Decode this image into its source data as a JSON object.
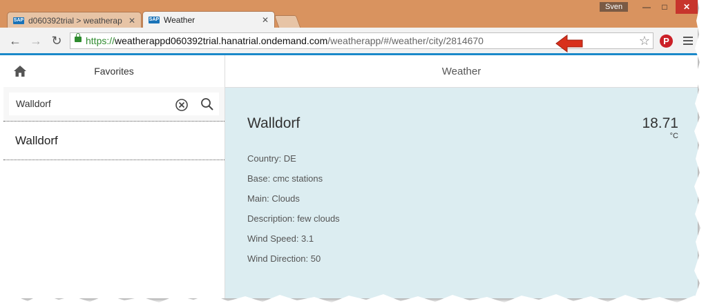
{
  "browser": {
    "tabs": [
      {
        "label": "d060392trial > weatherap",
        "favicon": "SAP",
        "active": false
      },
      {
        "label": "Weather",
        "favicon": "SAP",
        "active": true
      }
    ],
    "user": "Sven",
    "url": {
      "scheme": "https://",
      "host": "weatherappd060392trial.hanatrial.ondemand.com",
      "path": "/weatherapp/#/weather/city/2814670"
    },
    "pinterest_label": "P",
    "colors": {
      "frame": "#d9935f",
      "accent": "#1a88c9",
      "secure": "#2e8b2e",
      "annotation_arrow": "#d8301c"
    }
  },
  "master": {
    "title": "Favorites",
    "search": {
      "value": "Walldorf"
    },
    "items": [
      {
        "label": "Walldorf"
      }
    ]
  },
  "detail": {
    "title": "Weather",
    "city": "Walldorf",
    "temperature": "18.71",
    "unit": "°C",
    "attributes": [
      {
        "label": "Country: DE"
      },
      {
        "label": "Base: cmc stations"
      },
      {
        "label": "Main: Clouds"
      },
      {
        "label": "Description: few clouds"
      },
      {
        "label": "Wind Speed: 3.1"
      },
      {
        "label": "Wind Direction: 50"
      }
    ],
    "background": "#dcedf1"
  }
}
